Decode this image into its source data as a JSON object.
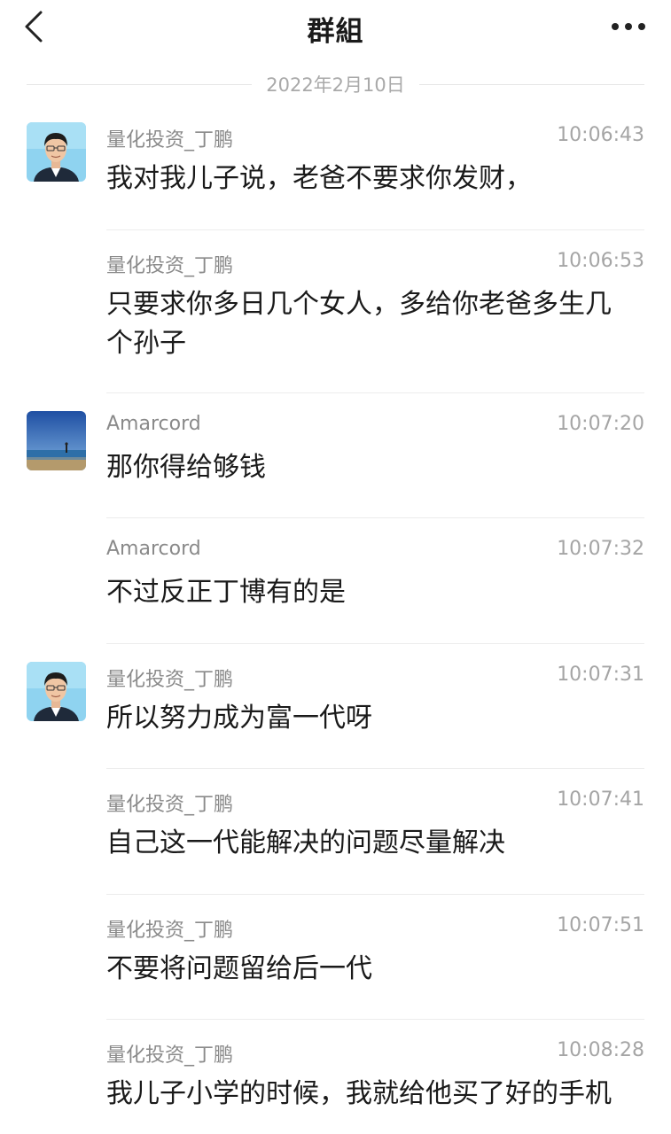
{
  "header": {
    "title": "群組",
    "back_icon": "chevron-left-icon",
    "more_icon": "more-horizontal-icon"
  },
  "date_separator": "2022年2月10日",
  "messages": [
    {
      "sender": "量化投资_丁鹏",
      "time": "10:06:43",
      "text": "我对我儿子说，老爸不要求你发财，",
      "avatar": "man-portrait"
    },
    {
      "sender": "量化投资_丁鹏",
      "time": "10:06:53",
      "text": "只要求你多日几个女人，多给你老爸多生几个孙子",
      "avatar": ""
    },
    {
      "sender": "Amarcord",
      "time": "10:07:20",
      "text": "那你得给够钱",
      "avatar": "beach-photo"
    },
    {
      "sender": "Amarcord",
      "time": "10:07:32",
      "text": "不过反正丁博有的是",
      "avatar": ""
    },
    {
      "sender": "量化投资_丁鹏",
      "time": "10:07:31",
      "text": "所以努力成为富一代呀",
      "avatar": "man-portrait"
    },
    {
      "sender": "量化投资_丁鹏",
      "time": "10:07:41",
      "text": "自己这一代能解决的问题尽量解决",
      "avatar": ""
    },
    {
      "sender": "量化投资_丁鹏",
      "time": "10:07:51",
      "text": "不要将问题留给后一代",
      "avatar": ""
    },
    {
      "sender": "量化投资_丁鹏",
      "time": "10:08:28",
      "text": "我儿子小学的时候，我就给他买了好的手机",
      "avatar": ""
    }
  ]
}
